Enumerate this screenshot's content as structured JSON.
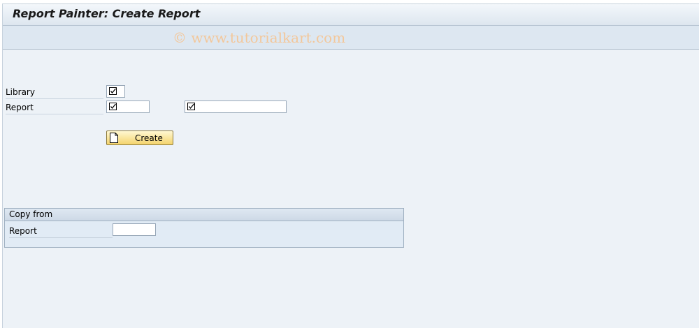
{
  "window": {
    "title": "Report Painter: Create Report"
  },
  "watermark": {
    "text": "© www.tutorialkart.com"
  },
  "form": {
    "library": {
      "label": "Library",
      "value": "",
      "required_icon": "required-check-icon"
    },
    "report": {
      "label": "Report",
      "value": "",
      "text_value": "",
      "required_icon": "required-check-icon"
    }
  },
  "toolbar": {
    "create_label": "Create",
    "create_icon": "document-icon"
  },
  "copy_from": {
    "title": "Copy from",
    "report": {
      "label": "Report",
      "value": ""
    }
  },
  "colors": {
    "background": "#edf2f7",
    "button_yellow": "#f4d36c",
    "watermark": "#f3c79a"
  }
}
